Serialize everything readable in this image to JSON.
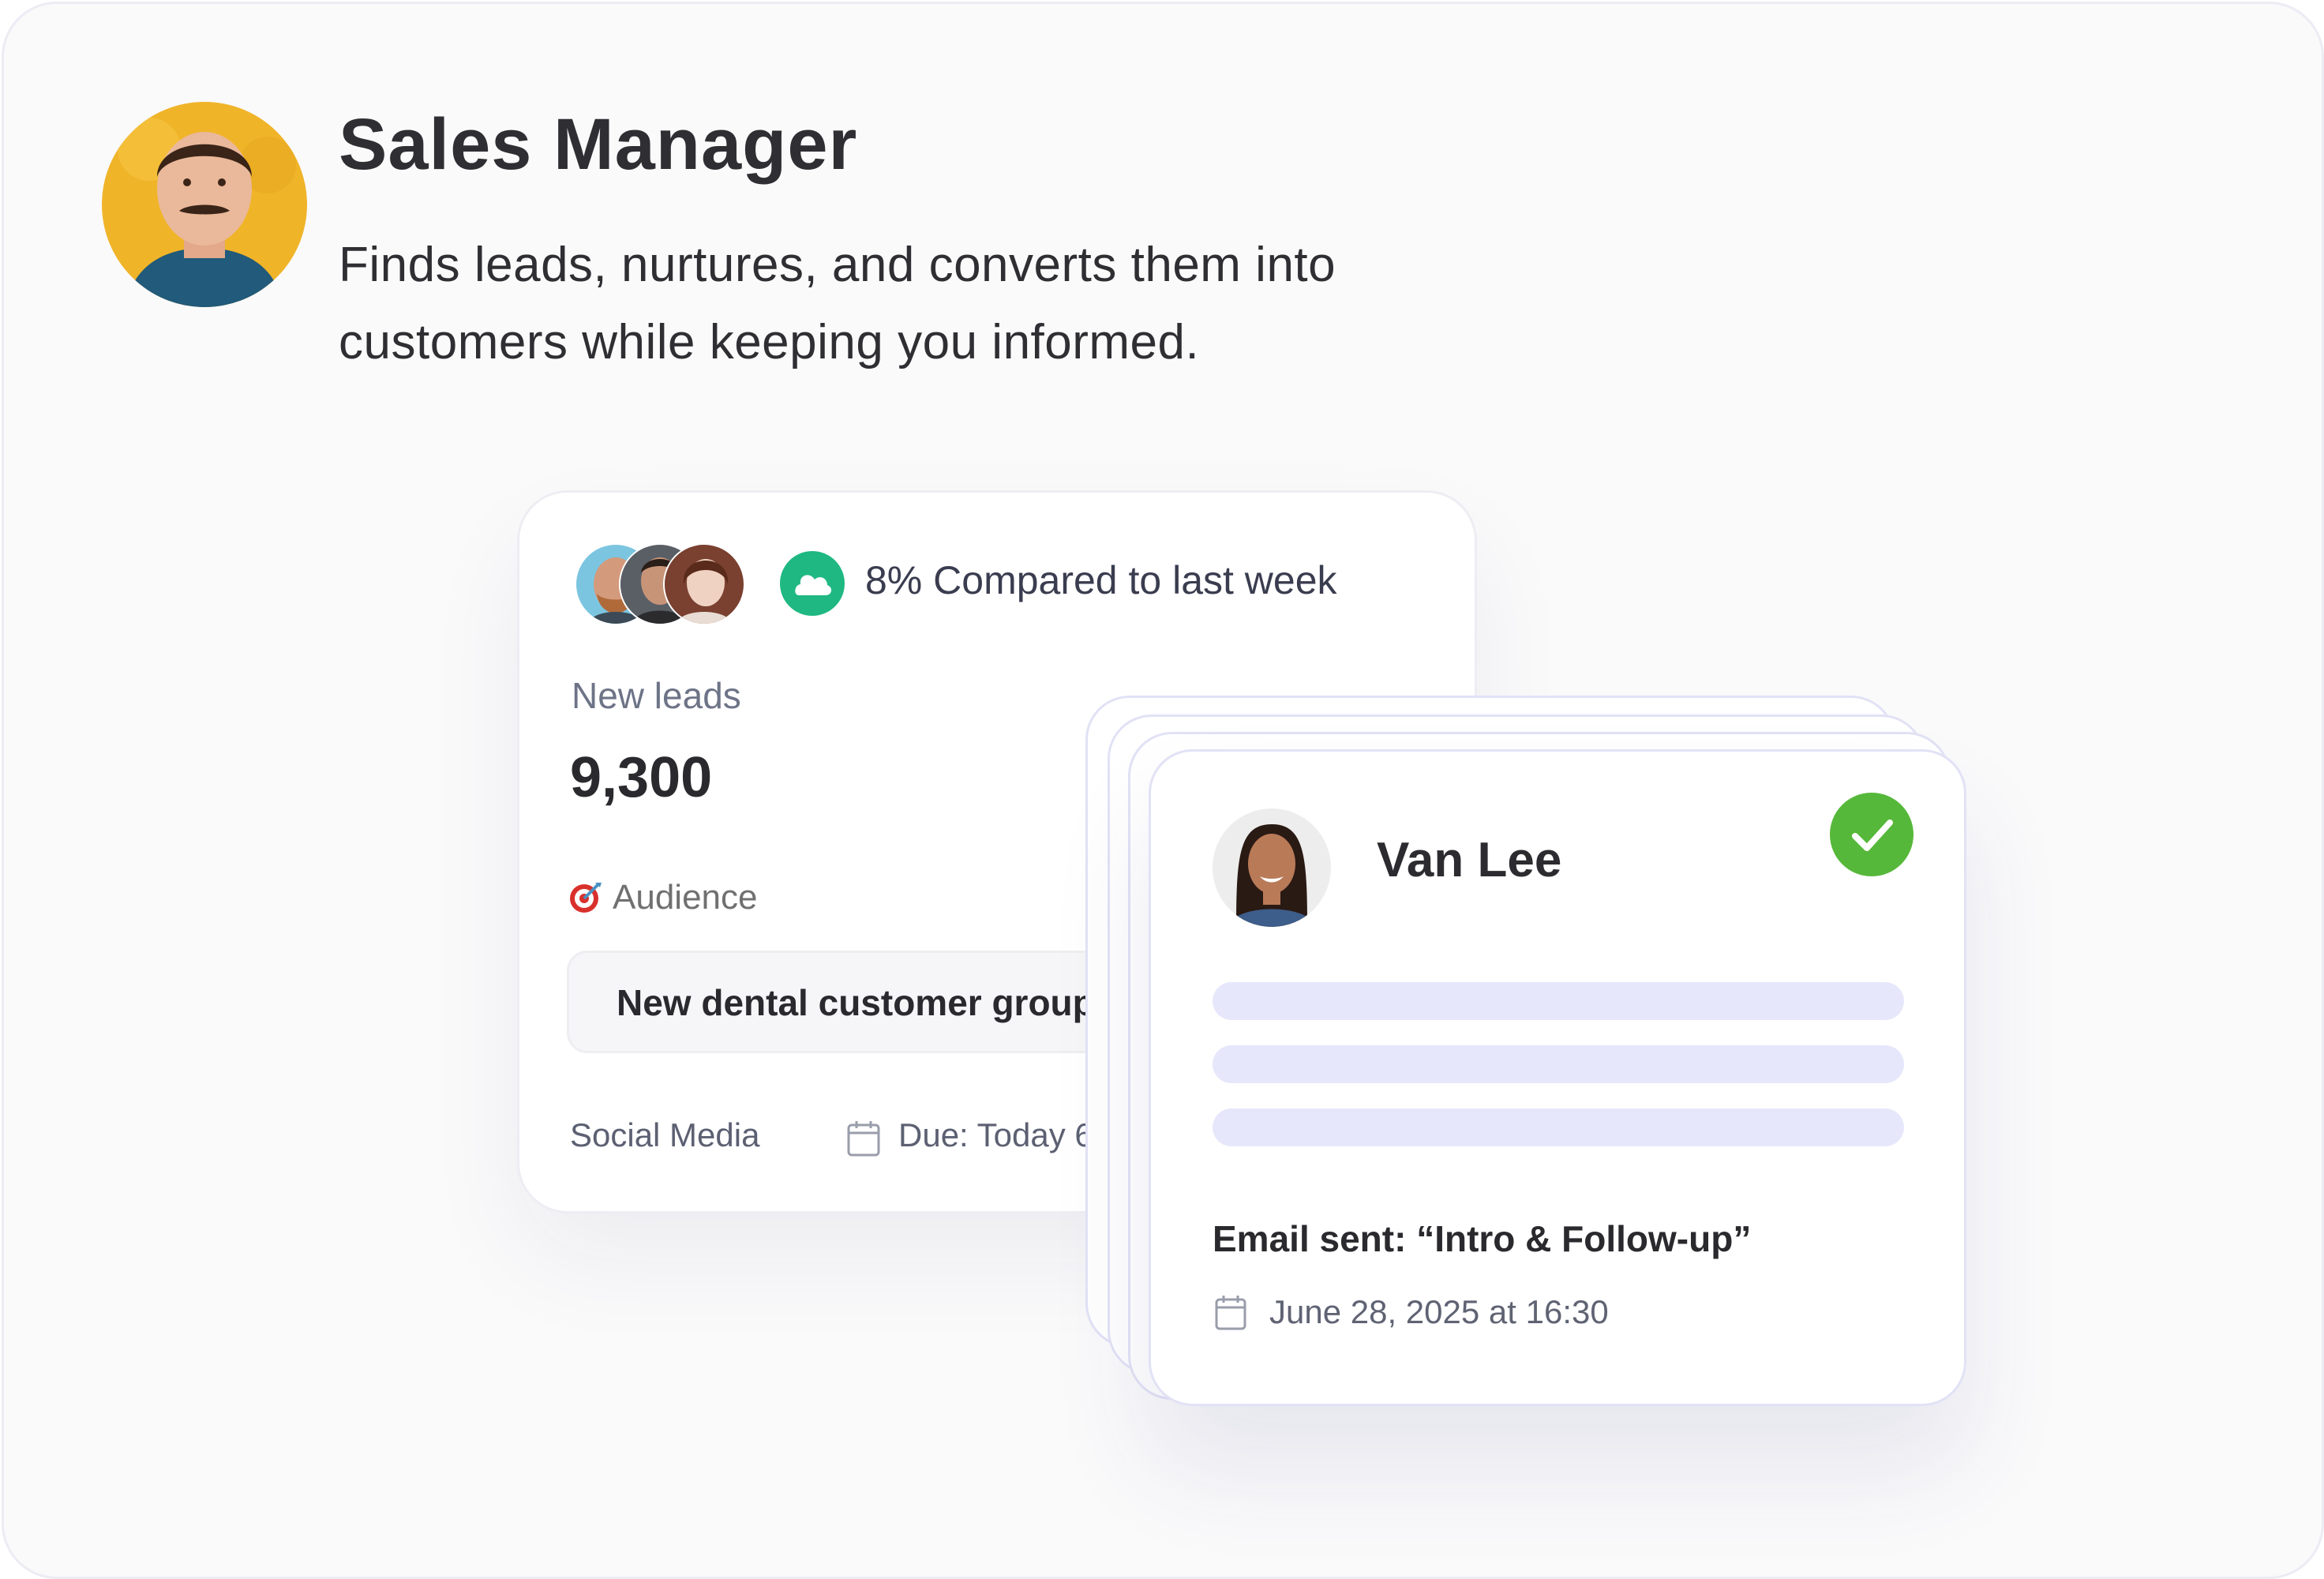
{
  "profile": {
    "title": "Sales Manager",
    "description": "Finds leads, nurtures, and converts them into customers while keeping you informed.",
    "avatar_icon": "person-portrait"
  },
  "stats_card": {
    "growth_text": "8% Compared to last week",
    "growth_color": "#1fb882",
    "leads_label": "New leads",
    "leads_value": "9,300",
    "audience_label": "Audience",
    "audience_value": "New dental customer group",
    "source": "Social Media",
    "due": "Due: Today 6"
  },
  "lead_card": {
    "name": "Van Lee",
    "status_icon": "check-circle",
    "status_color": "#56b83a",
    "email_text": "Email sent: “Intro & Follow-up”",
    "date_text": "June 28, 2025 at 16:30"
  }
}
